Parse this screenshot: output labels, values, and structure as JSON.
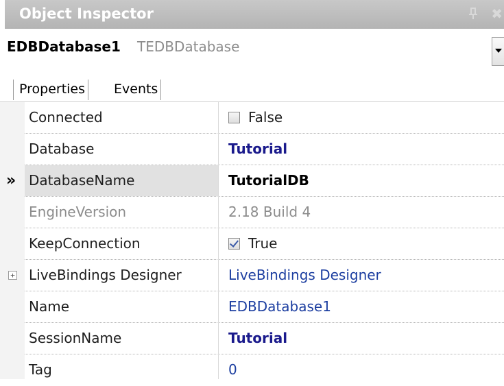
{
  "window": {
    "title": "Object Inspector"
  },
  "object": {
    "name": "EDBDatabase1",
    "type": "TEDBDatabase"
  },
  "tabs": [
    {
      "label": "Properties"
    },
    {
      "label": "Events"
    }
  ],
  "properties": [
    {
      "name": "Connected",
      "value": "False"
    },
    {
      "name": "Database",
      "value": "Tutorial"
    },
    {
      "name": "DatabaseName",
      "value": "TutorialDB"
    },
    {
      "name": "EngineVersion",
      "value": "2.18 Build 4"
    },
    {
      "name": "KeepConnection",
      "value": "True"
    },
    {
      "name": "LiveBindings Designer",
      "value": "LiveBindings Designer",
      "expander": "+"
    },
    {
      "name": "Name",
      "value": "EDBDatabase1"
    },
    {
      "name": "SessionName",
      "value": "Tutorial"
    },
    {
      "name": "Tag",
      "value": "0"
    }
  ],
  "selected_marker": "»",
  "colors": {
    "title_bar": "#b9b9b9",
    "reference_value": "#1a1a8c",
    "link_value": "#1c3ea0",
    "readonly": "#8c8c8c"
  }
}
